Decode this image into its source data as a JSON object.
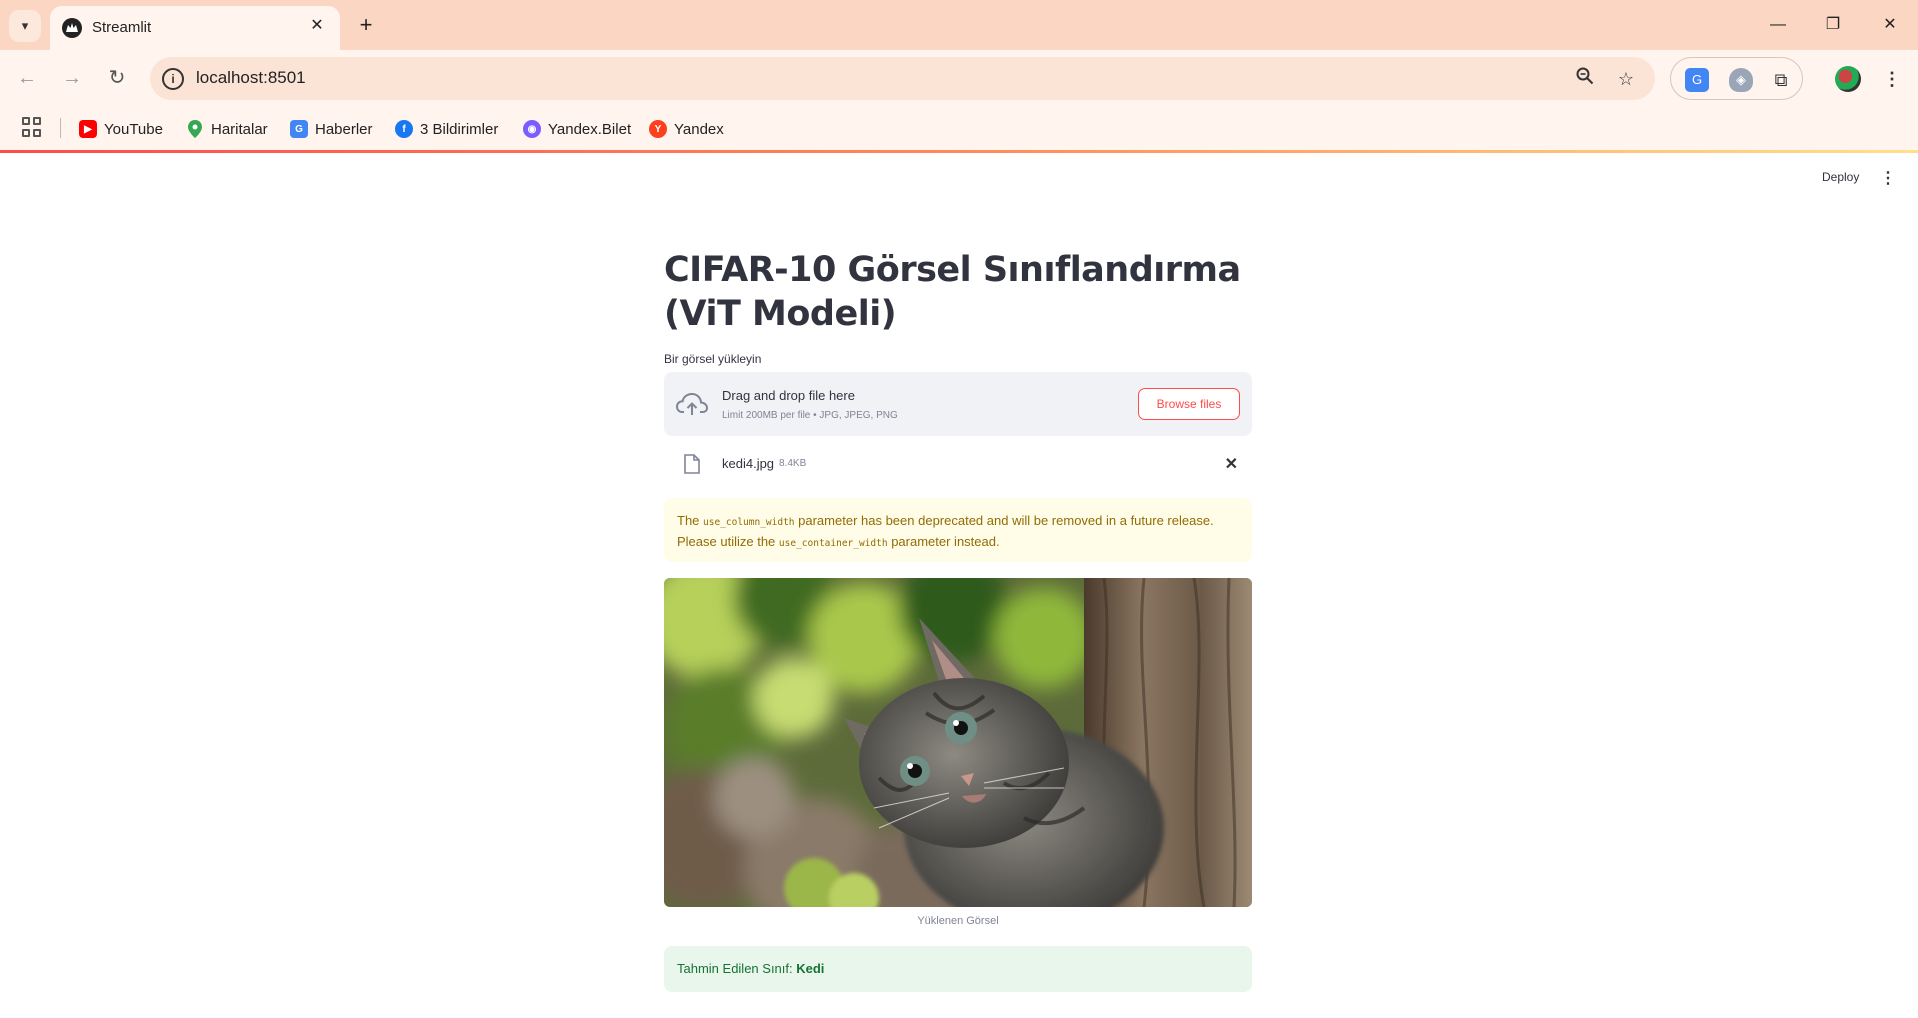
{
  "browser": {
    "tab_title": "Streamlit",
    "url": "localhost:8501",
    "bookmarks": [
      {
        "label": "YouTube",
        "icon": "youtube-icon",
        "color": "#ff0000"
      },
      {
        "label": "Haritalar",
        "icon": "maps-pin-icon",
        "color": "#34a853"
      },
      {
        "label": "Haberler",
        "icon": "news-icon",
        "color": "#4285f4"
      },
      {
        "label": "3 Bildirimler",
        "icon": "facebook-icon",
        "color": "#1877f2"
      },
      {
        "label": "Yandex.Bilet",
        "icon": "yandex-bilet-icon",
        "color": "#7b5cff"
      },
      {
        "label": "Yandex",
        "icon": "yandex-icon",
        "color": "#fc3f1d"
      }
    ]
  },
  "app": {
    "deploy_label": "Deploy",
    "title": "CIFAR-10 Görsel Sınıflandırma (ViT Modeli)",
    "uploader": {
      "label": "Bir görsel yükleyin",
      "drop_text": "Drag and drop file here",
      "limit_text": "Limit 200MB per file • JPG, JPEG, PNG",
      "browse_label": "Browse files",
      "file_name": "kedi4.jpg",
      "file_size": "8.4KB"
    },
    "warning": {
      "part1": "The ",
      "code1": "use_column_width",
      "part2": " parameter has been deprecated and will be removed in a future release. Please utilize the ",
      "code2": "use_container_width",
      "part3": " parameter instead."
    },
    "image_caption": "Yüklenen Görsel",
    "prediction": {
      "label": "Tahmin Edilen Sınıf: ",
      "value": "Kedi"
    }
  },
  "colors": {
    "primary": "#ff4b4b",
    "warning_bg": "#fffce7",
    "success_bg": "#e8f6ec",
    "chrome_tabbar": "#fbd7c3"
  }
}
